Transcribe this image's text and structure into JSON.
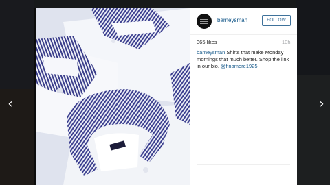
{
  "navigation": {
    "prev_glyph": "‹",
    "next_glyph": "›"
  },
  "post": {
    "username": "barneysman",
    "follow_label": "FOLLOW",
    "likes": "365 likes",
    "time": "10h",
    "caption": {
      "username": "barneysman",
      "text": "Shirts that make Monday mornings that much better. Shop the link in our bio.",
      "mention": "@finamore1925"
    }
  },
  "colors": {
    "link_blue": "#125688",
    "follow_blue": "#3f729b",
    "shirt_stripe": "#3c3f8f"
  },
  "icons": [
    "chevron-left-icon",
    "chevron-right-icon",
    "avatar-logo-icon"
  ]
}
